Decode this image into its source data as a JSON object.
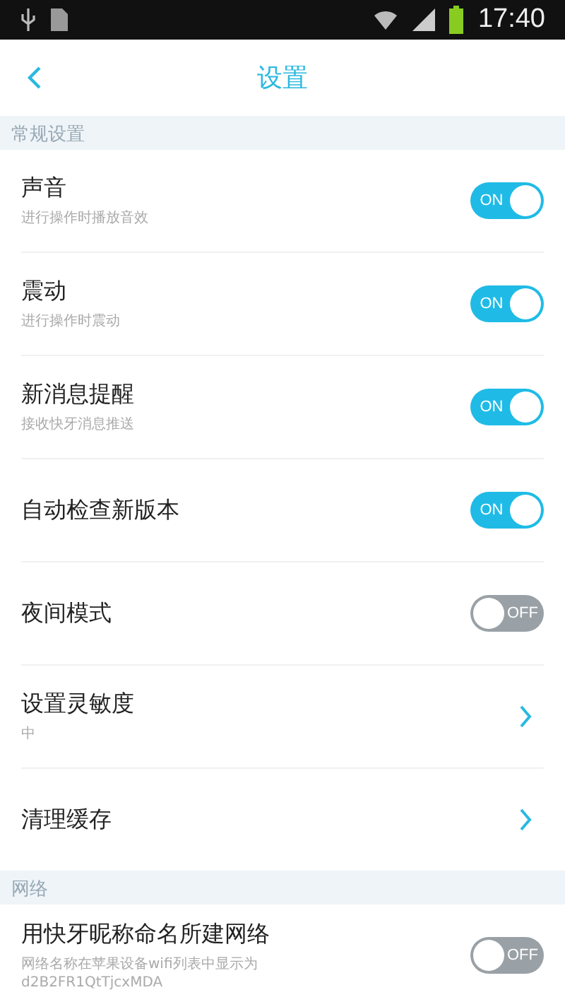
{
  "status_bar": {
    "time": "17:40"
  },
  "header": {
    "title": "设置"
  },
  "sections": [
    {
      "title": "常规设置",
      "rows": [
        {
          "kind": "toggle",
          "title": "声音",
          "subtitle": "进行操作时播放音效",
          "on": true,
          "switch_text": "ON"
        },
        {
          "kind": "toggle",
          "title": "震动",
          "subtitle": "进行操作时震动",
          "on": true,
          "switch_text": "ON"
        },
        {
          "kind": "toggle",
          "title": "新消息提醒",
          "subtitle": "接收快牙消息推送",
          "on": true,
          "switch_text": "ON"
        },
        {
          "kind": "toggle",
          "title": "自动检查新版本",
          "on": true,
          "switch_text": "ON"
        },
        {
          "kind": "toggle",
          "title": "夜间模式",
          "on": false,
          "switch_text": "OFF"
        },
        {
          "kind": "link",
          "title": "设置灵敏度",
          "subtitle": "中"
        },
        {
          "kind": "link",
          "title": "清理缓存"
        }
      ]
    },
    {
      "title": "网络",
      "rows": [
        {
          "kind": "toggle",
          "title": "用快牙昵称命名所建网络",
          "subtitle": "网络名称在苹果设备wifi列表中显示为d2B2FR1QtTjcxMDA",
          "on": false,
          "switch_text": "OFF"
        }
      ]
    }
  ]
}
